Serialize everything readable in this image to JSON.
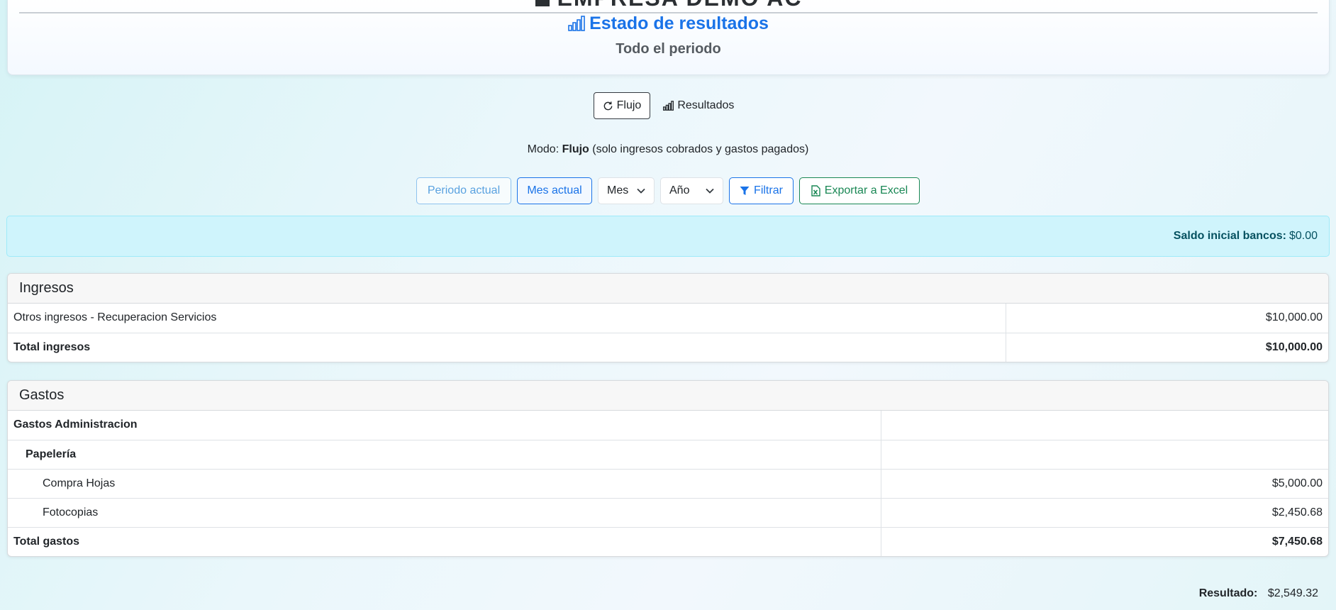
{
  "header": {
    "company": "EMPRESA DEMO AC",
    "title": "Estado de resultados",
    "subtitle": "Todo el periodo"
  },
  "mode_toggle": {
    "flujo_label": "Flujo",
    "resultados_label": "Resultados"
  },
  "modo": {
    "prefix": "Modo:",
    "name": "Flujo",
    "description": "(solo ingresos cobrados y gastos pagados)"
  },
  "filters": {
    "periodo_actual": "Periodo actual",
    "mes_actual": "Mes actual",
    "mes_select": "Mes",
    "anio_select": "Año",
    "filtrar": "Filtrar",
    "exportar": "Exportar a Excel"
  },
  "saldo": {
    "label": "Saldo inicial bancos:",
    "value": "$0.00"
  },
  "ingresos": {
    "title": "Ingresos",
    "rows": [
      {
        "label": "Otros ingresos - Recuperacion Servicios",
        "amount": "$10,000.00"
      }
    ],
    "total_label": "Total ingresos",
    "total_amount": "$10,000.00"
  },
  "gastos": {
    "title": "Gastos",
    "group": "Gastos Administracion",
    "subgroup": "Papelería",
    "rows": [
      {
        "label": "Compra Hojas",
        "amount": "$5,000.00"
      },
      {
        "label": "Fotocopias",
        "amount": "$2,450.68"
      }
    ],
    "total_label": "Total gastos",
    "total_amount": "$7,450.68"
  },
  "resultado": {
    "label": "Resultado:",
    "value": "$2,549.32"
  },
  "colors": {
    "primary": "#1a73e8",
    "success": "#198754",
    "info_bg": "#cff4fc",
    "info_text": "#055160"
  }
}
